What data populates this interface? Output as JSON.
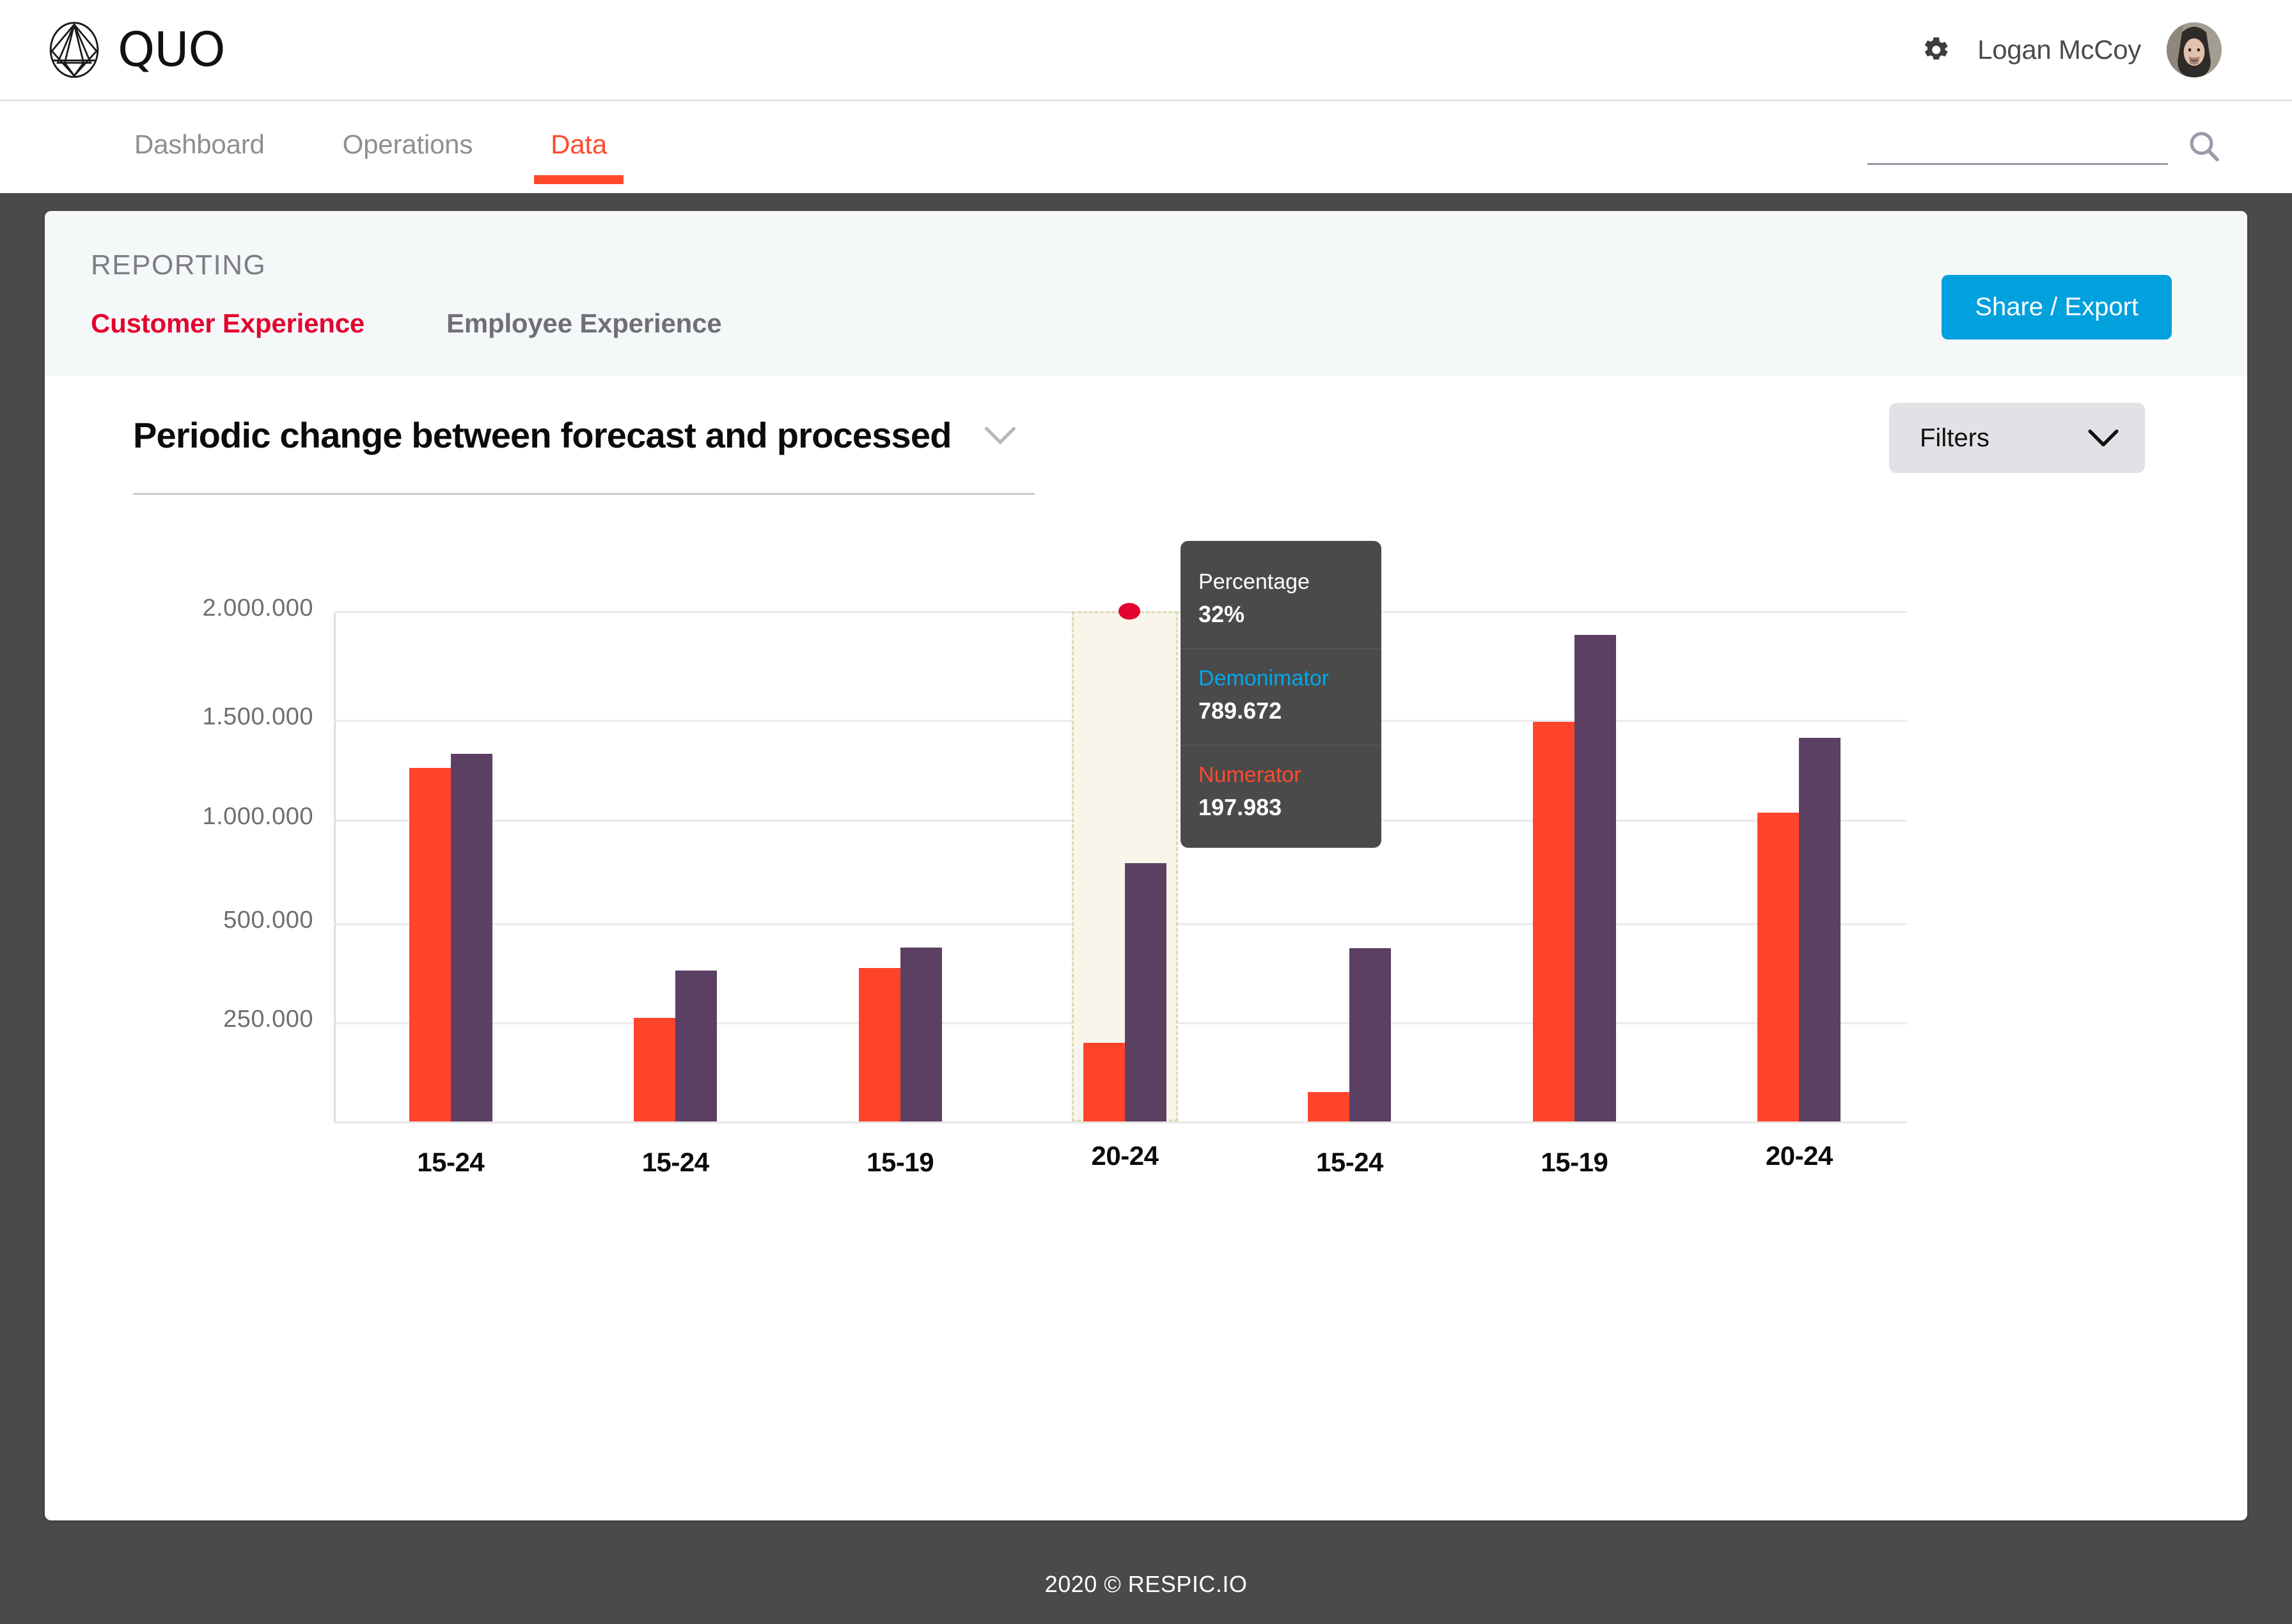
{
  "brand": {
    "name": "QUO",
    "logo_icon": "quo-gem-logo"
  },
  "topbar": {
    "gear_icon": "gear-icon",
    "user_name": "Logan McCoy",
    "avatar_icon": "user-avatar"
  },
  "nav": {
    "tabs": [
      {
        "label": "Dashboard",
        "active": false
      },
      {
        "label": "Operations",
        "active": false
      },
      {
        "label": "Data",
        "active": true
      }
    ],
    "search": {
      "value": "",
      "placeholder": "",
      "icon": "search-icon"
    }
  },
  "card": {
    "section_label": "REPORTING",
    "subtabs": [
      {
        "label": "Customer Experience",
        "active": true
      },
      {
        "label": "Employee Experience",
        "active": false
      }
    ],
    "share_export_label": "Share / Export"
  },
  "chart_header": {
    "title": "Periodic change between forecast and processed",
    "title_chevron_icon": "chevron-down-icon",
    "filters_label": "Filters",
    "filters_chevron_icon": "chevron-down-icon"
  },
  "tooltip": {
    "percentage_label": "Percentage",
    "percentage_value": "32%",
    "denominator_label": "Demonimator",
    "denominator_value": "789.672",
    "numerator_label": "Numerator",
    "numerator_value": "197.983"
  },
  "footer": {
    "text": "2020 © RESPIC.IO"
  },
  "colors": {
    "accent_red": "#ff4a2e",
    "crimson": "#e4032e",
    "blue": "#00a1dd",
    "cyan": "#00a8e8",
    "numerator_bar": "#ff442b",
    "denominator_bar": "#5b4063",
    "highlight_fill": "#f8f6ea",
    "dark_chrome": "#4a4a4a"
  },
  "chart_data": {
    "type": "bar",
    "title": "Periodic change between forecast and processed",
    "xlabel": "",
    "ylabel": "",
    "grid": true,
    "legend_position": "none",
    "categories": [
      "15-24",
      "15-24",
      "15-19",
      "20-24",
      "15-24",
      "15-19",
      "20-24"
    ],
    "ytick_labels": [
      "2.000.000",
      "1.500.000",
      "1.000.000",
      "500.000",
      "250.000"
    ],
    "ytick_values": [
      2000000,
      1500000,
      1000000,
      500000,
      250000
    ],
    "ylim": [
      0,
      2150000
    ],
    "series": [
      {
        "name": "Numerator",
        "color": "#ff442b",
        "values": [
          1260000,
          262000,
          387000,
          197983,
          75000,
          1490000,
          1035000
        ]
      },
      {
        "name": "Demonimator",
        "color": "#5b4063",
        "values": [
          1330000,
          380000,
          438000,
          789672,
          437000,
          1890000,
          1410000
        ]
      }
    ],
    "highlight": {
      "index": 3,
      "category": "20-24",
      "percentage": "32%",
      "marker_value": 2000000,
      "marker_color": "#e4032e"
    }
  }
}
